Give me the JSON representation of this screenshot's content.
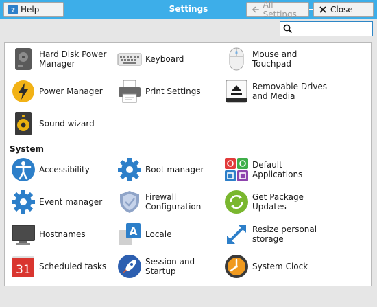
{
  "window": {
    "title": "Settings"
  },
  "search": {
    "placeholder": "",
    "value": ""
  },
  "sections": {
    "system_title": "System"
  },
  "items": {
    "hard_disk": "Hard Disk Power Manager",
    "keyboard": "Keyboard",
    "mouse": "Mouse and Touchpad",
    "power": "Power Manager",
    "print": "Print Settings",
    "removable": "Removable Drives and Media",
    "sound": "Sound wizard",
    "accessibility": "Accessibility",
    "boot": "Boot manager",
    "default_apps": "Default Applications",
    "event": "Event manager",
    "firewall": "Firewall Configuration",
    "packages": "Get Package Updates",
    "hostnames": "Hostnames",
    "locale": "Locale",
    "resize": "Resize personal storage",
    "scheduled": "Scheduled tasks",
    "session": "Session and Startup",
    "clock": "System Clock"
  },
  "icons": {
    "calendar_day": "31",
    "locale_letter": "A"
  },
  "buttons": {
    "help": "Help",
    "all_settings": "All Settings",
    "close": "Close"
  },
  "colors": {
    "titlebar": "#3daee9",
    "accent_blue": "#2d7fc9"
  }
}
